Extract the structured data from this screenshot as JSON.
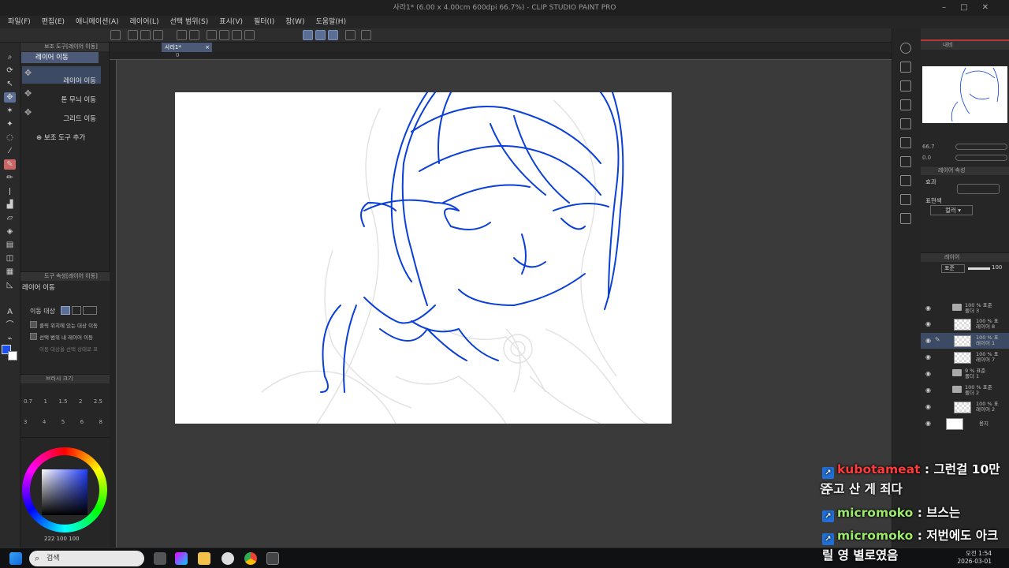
{
  "window": {
    "title": "사라1* (6.00 x 4.00cm 600dpi 66.7%)  - CLIP STUDIO PAINT PRO"
  },
  "menu": [
    "파일(F)",
    "편집(E)",
    "애니메이션(A)",
    "레이어(L)",
    "선택 범위(S)",
    "표시(V)",
    "필터(I)",
    "창(W)",
    "도움말(H)"
  ],
  "subtool": {
    "header": "보조 도구[레이어 이동]",
    "active": "레이어 이동",
    "items": [
      "레이어 이동",
      "톤 무늬 이동",
      "그리드 이동"
    ],
    "add_label": "보조 도구 추가"
  },
  "tool_property": {
    "header": "도구 속성[레이어 이동]",
    "title": "레이어 이동",
    "target_label": "이동 대상",
    "option1": "클릭 위치에 있는 대상 이동",
    "option2": "선택 범위 내 레이어 이동",
    "note": "이동 대상을 선택 상태로 표"
  },
  "brush_size": {
    "header": "브러시 크기",
    "values": [
      "0.7",
      "1",
      "1.5",
      "2",
      "2.5",
      "3",
      "4",
      "5",
      "6",
      "8"
    ]
  },
  "color": {
    "current": "#1a4ff0",
    "values": "222  100  100"
  },
  "canvas": {
    "tab_label": "사라1*",
    "ruler_zero": "0",
    "stroke_color": "#0a3fd8"
  },
  "navigator": {
    "title": "내비",
    "zoom": "66.7",
    "angle": "0.0"
  },
  "layer_property": {
    "title": "레이어 속성",
    "effect_label": "효과",
    "expression_label": "표현색",
    "expression_value": "컬러"
  },
  "layers_panel": {
    "title": "레이어",
    "blend": "표준",
    "opacity": "100",
    "items": [
      {
        "line1": "100 % 표준",
        "line2": "폴더 3",
        "type": "folder"
      },
      {
        "line1": "100 % 표",
        "line2": "레이어 8",
        "type": "layer"
      },
      {
        "line1": "100 % 표",
        "line2": "레이어 1",
        "type": "layer",
        "selected": true
      },
      {
        "line1": "100 % 표",
        "line2": "레이어 7",
        "type": "layer"
      },
      {
        "line1": "9 % 표준",
        "line2": "폴더 1",
        "type": "folder"
      },
      {
        "line1": "100 % 표준",
        "line2": "폴더 2",
        "type": "folder"
      },
      {
        "line1": "100 % 표",
        "line2": "레이어 2",
        "type": "layer"
      },
      {
        "line1": "용지",
        "line2": "",
        "type": "paper"
      }
    ]
  },
  "chat": [
    {
      "user": "kubotameat",
      "user_color": "#ff3b3b",
      "text": ": 그런걸 10만원",
      "cont": "주고 산 게 죄다"
    },
    {
      "user": "micromoko",
      "user_color": "#9bea6a",
      "text": ": 브스는",
      "cont": ""
    },
    {
      "user": "micromoko",
      "user_color": "#9bea6a",
      "text": ": 저번에도 아크",
      "cont": "릴 영 별로였음"
    }
  ],
  "taskbar": {
    "search_placeholder": "검색",
    "time": "오전 1:54",
    "date": "2026-03-01"
  }
}
